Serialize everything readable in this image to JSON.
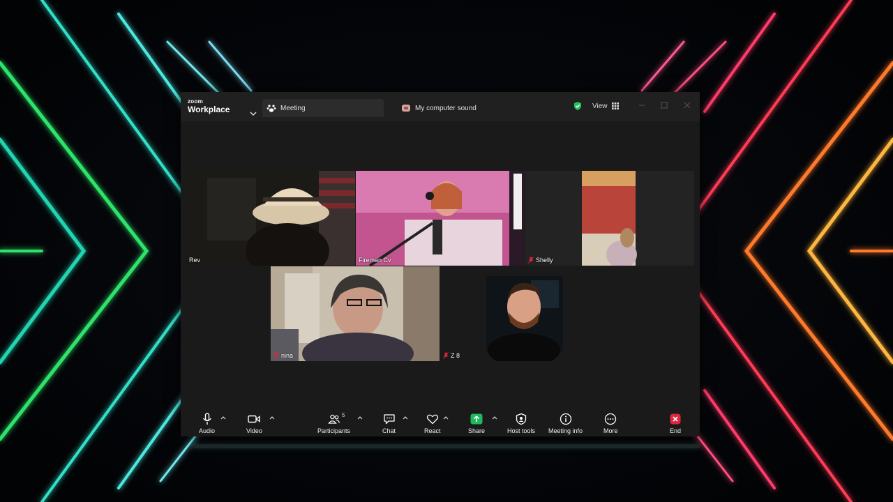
{
  "app": {
    "brand_small": "zoom",
    "brand_big": "Workplace"
  },
  "tabs": [
    {
      "label": "Meeting"
    },
    {
      "label": "My computer sound"
    }
  ],
  "view_label": "View",
  "participants": [
    {
      "name": "Rev",
      "muted": false,
      "active_speaker": true
    },
    {
      "name": "Fireman Cv",
      "muted": false,
      "active_speaker": false
    },
    {
      "name": "Shelly",
      "muted": true,
      "active_speaker": false
    },
    {
      "name": "nina",
      "muted": true,
      "active_speaker": false
    },
    {
      "name": "Z 8",
      "muted": true,
      "active_speaker": false
    }
  ],
  "toolbar": {
    "audio": "Audio",
    "video": "Video",
    "participants": "Participants",
    "participants_count": "5",
    "chat": "Chat",
    "react": "React",
    "share": "Share",
    "host_tools": "Host tools",
    "meeting_info": "Meeting info",
    "more": "More",
    "end": "End"
  },
  "colors": {
    "active_speaker_border": "#34d17b",
    "share_green": "#1fb85c",
    "end_red": "#e0263a",
    "shield_green": "#22c35e"
  }
}
